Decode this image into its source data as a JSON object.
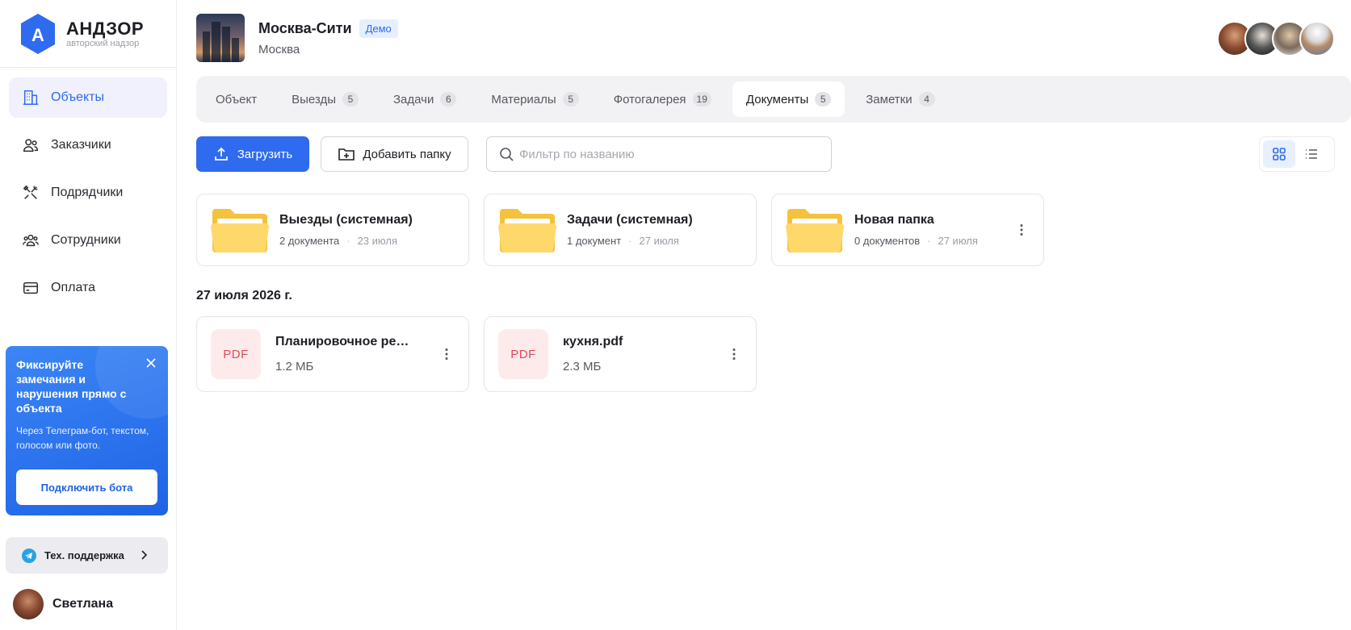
{
  "brand": {
    "title": "АНДЗОР",
    "subtitle": "авторский надзор",
    "logo_letter": "А"
  },
  "nav": [
    {
      "label": "Объекты",
      "icon": "building-icon",
      "active": true
    },
    {
      "label": "Заказчики",
      "icon": "users-icon",
      "active": false
    },
    {
      "label": "Подрядчики",
      "icon": "tools-icon",
      "active": false
    },
    {
      "label": "Сотрудники",
      "icon": "team-icon",
      "active": false
    },
    {
      "label": "Оплата",
      "icon": "card-icon",
      "active": false
    }
  ],
  "promo": {
    "title": "Фиксируйте замечания и нарушения прямо с объекта",
    "text": "Через Телеграм-бот, текстом, голосом или фото.",
    "button": "Подключить бота"
  },
  "support": {
    "label": "Тех. поддержка"
  },
  "user": {
    "name": "Светлана"
  },
  "project": {
    "title": "Москва-Сити",
    "badge": "Демо",
    "city": "Москва"
  },
  "tabs": [
    {
      "label": "Объект",
      "count": null
    },
    {
      "label": "Выезды",
      "count": "5"
    },
    {
      "label": "Задачи",
      "count": "6"
    },
    {
      "label": "Материалы",
      "count": "5"
    },
    {
      "label": "Фотогалерея",
      "count": "19"
    },
    {
      "label": "Документы",
      "count": "5",
      "active": true
    },
    {
      "label": "Заметки",
      "count": "4"
    }
  ],
  "toolbar": {
    "upload": "Загрузить",
    "add_folder": "Добавить папку",
    "search_placeholder": "Фильтр по названию"
  },
  "folders": [
    {
      "name": "Выезды (системная)",
      "count": "2 документа",
      "date": "23 июля",
      "menu": false
    },
    {
      "name": "Задачи (системная)",
      "count": "1 документ",
      "date": "27 июля",
      "menu": false
    },
    {
      "name": "Новая папка",
      "count": "0 документов",
      "date": "27 июля",
      "menu": true
    }
  ],
  "section_date": "27 июля 2026 г.",
  "files": [
    {
      "type": "PDF",
      "name": "Планировочное решение.pdf",
      "size": "1.2 МБ"
    },
    {
      "type": "PDF",
      "name": "кухня.pdf",
      "size": "2.3 МБ"
    }
  ],
  "colors": {
    "accent": "#2f6bef",
    "folder": "#ffd86b",
    "pdf": "#e04a55"
  }
}
